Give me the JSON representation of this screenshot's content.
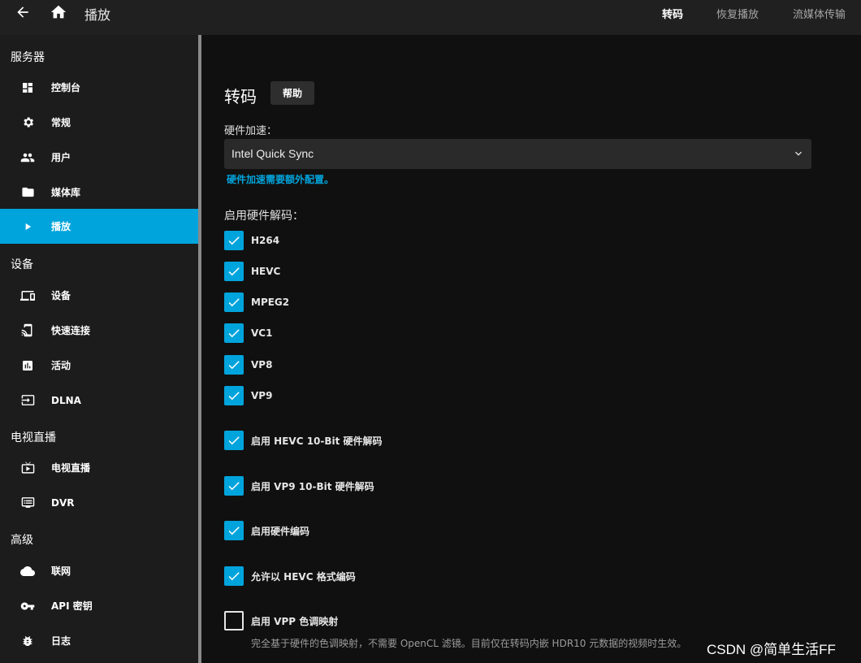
{
  "header": {
    "title": "播放",
    "tabs": [
      "转码",
      "恢复播放",
      "流媒体传输"
    ]
  },
  "sidebar": {
    "sections": [
      {
        "title": "服务器",
        "items": [
          {
            "label": "控制台",
            "icon": "dashboard-icon"
          },
          {
            "label": "常规",
            "icon": "gear-icon"
          },
          {
            "label": "用户",
            "icon": "users-icon"
          },
          {
            "label": "媒体库",
            "icon": "folder-icon"
          },
          {
            "label": "播放",
            "icon": "play-icon",
            "active": true
          }
        ]
      },
      {
        "title": "设备",
        "items": [
          {
            "label": "设备",
            "icon": "devices-icon"
          },
          {
            "label": "快速连接",
            "icon": "cast-icon"
          },
          {
            "label": "活动",
            "icon": "activity-icon"
          },
          {
            "label": "DLNA",
            "icon": "input-icon"
          }
        ]
      },
      {
        "title": "电视直播",
        "items": [
          {
            "label": "电视直播",
            "icon": "live-tv-icon"
          },
          {
            "label": "DVR",
            "icon": "dvr-icon"
          }
        ]
      },
      {
        "title": "高级",
        "items": [
          {
            "label": "联网",
            "icon": "cloud-icon"
          },
          {
            "label": "API 密钥",
            "icon": "key-icon"
          },
          {
            "label": "日志",
            "icon": "bug-icon"
          }
        ]
      }
    ]
  },
  "main": {
    "section_title": "转码",
    "help_label": "帮助",
    "hw_accel_label": "硬件加速：",
    "hw_accel_value": "Intel Quick Sync",
    "hw_accel_note": "硬件加速需要额外配置。",
    "decode_label": "启用硬件解码：",
    "codecs": [
      {
        "label": "H264",
        "checked": true
      },
      {
        "label": "HEVC",
        "checked": true
      },
      {
        "label": "MPEG2",
        "checked": true
      },
      {
        "label": "VC1",
        "checked": true
      },
      {
        "label": "VP8",
        "checked": true
      },
      {
        "label": "VP9",
        "checked": true
      }
    ],
    "options": [
      {
        "label": "启用 HEVC 10-Bit 硬件解码",
        "checked": true
      },
      {
        "label": "启用 VP9 10-Bit 硬件解码",
        "checked": true
      },
      {
        "label": "启用硬件编码",
        "checked": true
      },
      {
        "label": "允许以 HEVC 格式编码",
        "checked": true
      },
      {
        "label": "启用 VPP 色调映射",
        "checked": false
      }
    ],
    "vpp_description": "完全基于硬件的色调映射，不需要 OpenCL 滤镜。目前仅在转码内嵌 HDR10 元数据的视频时生效。"
  },
  "watermark": "CSDN @简单生活FF",
  "colors": {
    "accent": "#00a4dc",
    "background": "#101010",
    "sidebar": "#1c1c1c",
    "header": "#202020"
  }
}
